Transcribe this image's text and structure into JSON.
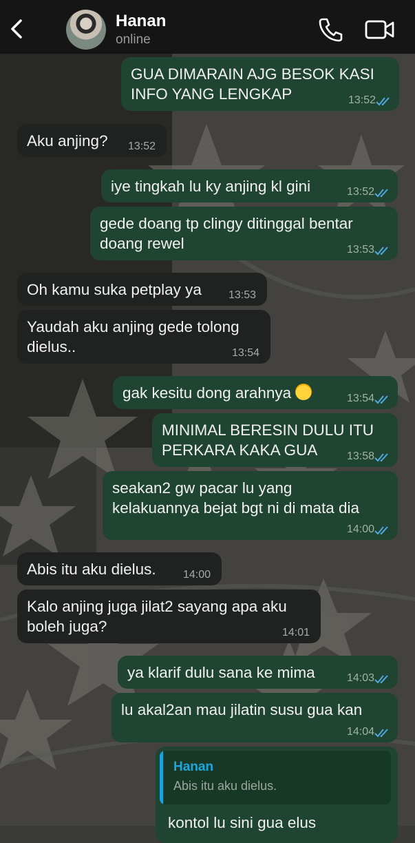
{
  "header": {
    "back_icon": "chevron-left-icon",
    "contact_name": "Hanan",
    "status": "online",
    "call_icon": "phone-icon",
    "video_icon": "video-camera-icon"
  },
  "colors": {
    "header_bg": "#151515",
    "outgoing_bubble": "#1f4431",
    "incoming_bubble": "#202222",
    "read_ticks": "#4fa8e0",
    "reply_accent": "#1da6dd"
  },
  "messages": [
    {
      "dir": "out",
      "lines": [
        "GUA DIMARAIN AJG BESOK KASI",
        "INFO YANG LENGKAP"
      ],
      "time": "13:52",
      "read": true
    },
    {
      "dir": "in",
      "lines": [
        "Aku anjing?"
      ],
      "time": "13:52"
    },
    {
      "dir": "out",
      "lines": [
        "iye tingkah lu ky anjing kl gini"
      ],
      "time": "13:52",
      "read": true
    },
    {
      "dir": "out",
      "lines": [
        "gede doang tp clingy ditinggal bentar",
        "doang rewel"
      ],
      "time": "13:53",
      "read": true
    },
    {
      "dir": "in",
      "lines": [
        "Oh kamu suka petplay ya"
      ],
      "time": "13:53"
    },
    {
      "dir": "in",
      "lines": [
        "Yaudah aku anjing gede tolong",
        "dielus.."
      ],
      "time": "13:54"
    },
    {
      "dir": "out",
      "lines": [
        "gak kesitu dong arahnya"
      ],
      "emoji": "loudly-crying-face-icon",
      "time": "13:54",
      "read": true
    },
    {
      "dir": "out",
      "lines": [
        "MINIMAL BERESIN DULU ITU",
        "PERKARA KAKA GUA"
      ],
      "time": "13:58",
      "read": true
    },
    {
      "dir": "out",
      "lines": [
        "seakan2 gw pacar lu yang",
        "kelakuannya bejat bgt ni di mata dia"
      ],
      "time": "14:00",
      "read": true
    },
    {
      "dir": "in",
      "lines": [
        "Abis itu aku dielus."
      ],
      "time": "14:00"
    },
    {
      "dir": "in",
      "lines": [
        "Kalo anjing juga jilat2 sayang apa aku",
        "boleh juga?"
      ],
      "time": "14:01"
    },
    {
      "dir": "out",
      "lines": [
        "ya klarif dulu sana ke mima"
      ],
      "time": "14:03",
      "read": true
    },
    {
      "dir": "out",
      "lines": [
        "lu akal2an mau jilatin susu gua kan"
      ],
      "time": "14:04",
      "read": true
    }
  ],
  "reply_message": {
    "quoted_name": "Hanan",
    "quoted_text": "Abis itu aku dielus.",
    "text": "kontol lu sini gua elus"
  }
}
